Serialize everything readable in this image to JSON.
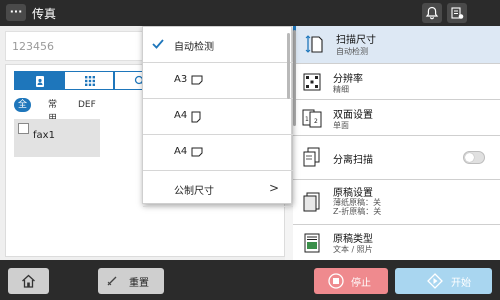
{
  "header": {
    "menu_label": "···",
    "title": "传真",
    "icons": [
      "bell-icon",
      "device-status-icon"
    ]
  },
  "left_panel": {
    "destination_value": "123456",
    "tabs": [
      {
        "icon": "address-book-icon",
        "active": true
      },
      {
        "icon": "keypad-icon",
        "active": false
      },
      {
        "icon": "search-icon",
        "active": false
      }
    ],
    "chips": [
      {
        "label": "全部",
        "active": true
      },
      {
        "label": "常用",
        "active": false
      },
      {
        "label": "DEF",
        "active": false
      }
    ],
    "entries": [
      {
        "name": "fax1",
        "checked": false
      }
    ]
  },
  "dropdown": {
    "items": [
      {
        "label": "自动检测",
        "checked": true,
        "icon": ""
      },
      {
        "label": "A3",
        "checked": false,
        "icon": "landscape-page-icon"
      },
      {
        "label": "A4",
        "checked": false,
        "icon": "portrait-page-icon"
      },
      {
        "label": "A4",
        "checked": false,
        "icon": "landscape-page-icon"
      },
      {
        "label": "公制尺寸",
        "checked": false,
        "icon": "",
        "submenu": true,
        "arrow": ">"
      }
    ]
  },
  "settings": [
    {
      "title": "扫描尺寸",
      "lines": [
        "自动检测"
      ],
      "icon": "scan-size-icon",
      "selected": true
    },
    {
      "title": "分辨率",
      "lines": [
        "精细"
      ],
      "icon": "resolution-icon",
      "selected": false
    },
    {
      "title": "双面设置",
      "lines": [
        "单面"
      ],
      "icon": "duplex-icon",
      "selected": false
    },
    {
      "title": "分离扫描",
      "lines": [],
      "icon": "separate-scan-icon",
      "selected": false,
      "toggle": false
    },
    {
      "title": "原稿设置",
      "lines": [
        "薄纸原稿：关",
        "Z-折原稿：关"
      ],
      "icon": "original-settings-icon",
      "selected": false
    },
    {
      "title": "原稿类型",
      "lines": [
        "文本 / 照片"
      ],
      "icon": "original-type-icon",
      "selected": false
    }
  ],
  "footer": {
    "home_icon": "home-icon",
    "reset_label": "重置",
    "stop_label": "停止",
    "start_label": "开始"
  },
  "colors": {
    "accent": "#1e76bb",
    "stop": "#ef8a8e",
    "start": "#a9d6f0",
    "topbar": "#2b2b2b"
  }
}
